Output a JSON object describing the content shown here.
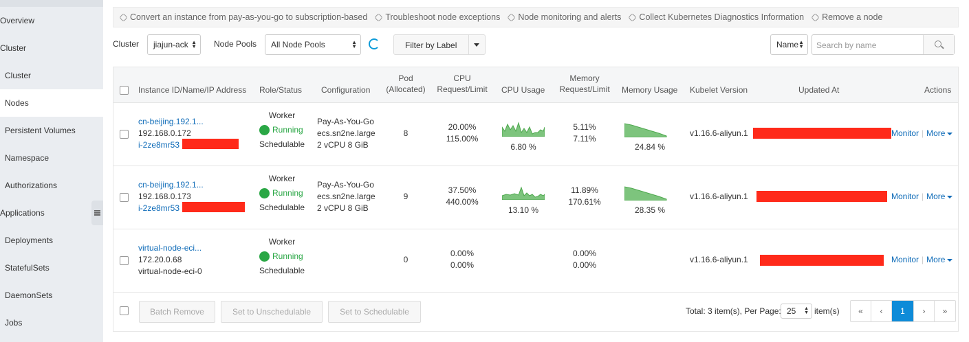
{
  "sidebar": {
    "items": [
      {
        "label": "Overview",
        "kind": "group"
      },
      {
        "label": "Cluster",
        "kind": "group"
      },
      {
        "label": "Cluster",
        "kind": "sub"
      },
      {
        "label": "Nodes",
        "kind": "sub",
        "active": true
      },
      {
        "label": "Persistent Volumes",
        "kind": "sub"
      },
      {
        "label": "Namespace",
        "kind": "sub"
      },
      {
        "label": "Authorizations",
        "kind": "sub"
      },
      {
        "label": "Applications",
        "kind": "group"
      },
      {
        "label": "Deployments",
        "kind": "sub"
      },
      {
        "label": "StatefulSets",
        "kind": "sub"
      },
      {
        "label": "DaemonSets",
        "kind": "sub"
      },
      {
        "label": "Jobs",
        "kind": "sub"
      }
    ]
  },
  "quick_links": [
    "Convert an instance from pay-as-you-go to subscription-based",
    "Troubleshoot node exceptions",
    "Node monitoring and alerts",
    "Collect Kubernetes Diagnostics Information",
    "Remove a node"
  ],
  "toolbar": {
    "cluster_label": "Cluster",
    "cluster_value": "jiajun-ack",
    "node_pools_label": "Node Pools",
    "node_pools_value": "All Node Pools",
    "filter_label": "Filter by Label",
    "search_field": "Name",
    "search_placeholder": "Search by name"
  },
  "table": {
    "headers": {
      "instance": "Instance ID/Name/IP Address",
      "role": "Role/Status",
      "config": "Configuration",
      "pod_1": "Pod",
      "pod_2": "(Allocated)",
      "cpu_1": "CPU",
      "cpu_2": "Request/Limit",
      "cpu_usage": "CPU Usage",
      "mem_1": "Memory",
      "mem_2": "Request/Limit",
      "mem_usage": "Memory Usage",
      "kubelet": "Kubelet Version",
      "updated": "Updated At",
      "actions": "Actions"
    },
    "rows": [
      {
        "name": "cn-beijing.192.1...",
        "ip": "192.168.0.172",
        "id": "i-2ze8mr53",
        "role": "Worker",
        "status": "Running",
        "sched": "Schedulable",
        "config_1": "Pay-As-You-Go",
        "config_2": "ecs.sn2ne.large",
        "config_3": "2 vCPU 8 GiB",
        "pods": "8",
        "cpu_req": "20.00%",
        "cpu_lim": "115.00%",
        "cpu_usage": "6.80 %",
        "mem_req": "5.11%",
        "mem_lim": "7.11%",
        "mem_usage": "24.84 %",
        "kubelet": "v1.16.6-aliyun.1",
        "monitor": "Monitor",
        "more": "More"
      },
      {
        "name": "cn-beijing.192.1...",
        "ip": "192.168.0.173",
        "id": "i-2ze8mr53",
        "role": "Worker",
        "status": "Running",
        "sched": "Schedulable",
        "config_1": "Pay-As-You-Go",
        "config_2": "ecs.sn2ne.large",
        "config_3": "2 vCPU 8 GiB",
        "pods": "9",
        "cpu_req": "37.50%",
        "cpu_lim": "440.00%",
        "cpu_usage": "13.10 %",
        "mem_req": "11.89%",
        "mem_lim": "170.61%",
        "mem_usage": "28.35 %",
        "kubelet": "v1.16.6-aliyun.1",
        "monitor": "Monitor",
        "more": "More"
      },
      {
        "name": "virtual-node-eci...",
        "ip": "172.20.0.68",
        "id": "virtual-node-eci-0",
        "role": "Worker",
        "status": "Running",
        "sched": "Schedulable",
        "pods": "0",
        "cpu_req": "0.00%",
        "cpu_lim": "0.00%",
        "mem_req": "0.00%",
        "mem_lim": "0.00%",
        "kubelet": "v1.16.6-aliyun.1",
        "monitor": "Monitor",
        "more": "More"
      }
    ]
  },
  "footer": {
    "batch_remove": "Batch Remove",
    "set_unsched": "Set to Unschedulable",
    "set_sched": "Set to Schedulable",
    "total": "Total: 3 item(s), Per Page:",
    "per_page": "25",
    "items": "item(s)",
    "first": "«",
    "prev": "‹",
    "page": "1",
    "next": "›",
    "last": "»"
  },
  "colors": {
    "accent": "#0e8bd8",
    "link": "#0e6bb8",
    "running": "#2aa745",
    "redaction": "#ff2a1a",
    "spark": "#7dc47d"
  }
}
